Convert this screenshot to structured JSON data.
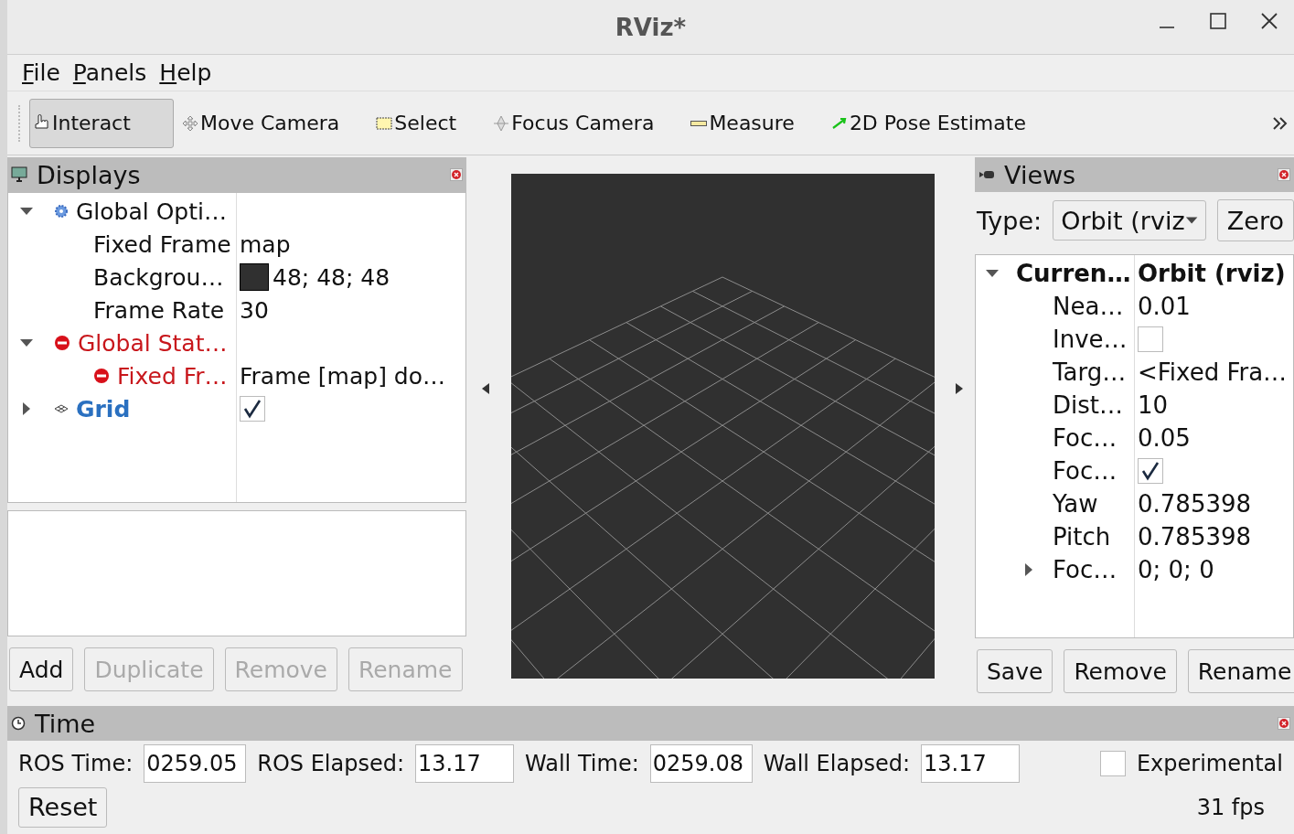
{
  "window": {
    "title": "RViz*"
  },
  "menu": [
    {
      "label": "File"
    },
    {
      "label": "Panels"
    },
    {
      "label": "Help"
    }
  ],
  "tools": [
    {
      "label": "Interact",
      "kind": "interact",
      "selected": true
    },
    {
      "label": "Move Camera",
      "kind": "move",
      "selected": false
    },
    {
      "label": "Select",
      "kind": "select",
      "selected": false
    },
    {
      "label": "Focus Camera",
      "kind": "focus",
      "selected": false
    },
    {
      "label": "Measure",
      "kind": "measure",
      "selected": false
    },
    {
      "label": "2D Pose Estimate",
      "kind": "pose",
      "selected": false
    }
  ],
  "displays": {
    "title": "Displays",
    "tree": [
      {
        "label": "Global Opti…",
        "kind": "options",
        "expanded": true,
        "children": [
          {
            "label": "Fixed Frame",
            "value": "map"
          },
          {
            "label": "Backgrou…",
            "value": "48; 48; 48",
            "color": "#303030"
          },
          {
            "label": "Frame Rate",
            "value": "30"
          }
        ]
      },
      {
        "label": "Global Stat…",
        "kind": "error",
        "expanded": true,
        "children": [
          {
            "label": "Fixed Fr…",
            "kind": "error",
            "value": "Frame [map] do…"
          }
        ]
      },
      {
        "label": "Grid",
        "kind": "grid",
        "expanded": false,
        "checked": true
      }
    ],
    "buttons": [
      {
        "label": "Add",
        "disabled": false
      },
      {
        "label": "Duplicate",
        "disabled": true
      },
      {
        "label": "Remove",
        "disabled": true
      },
      {
        "label": "Rename",
        "disabled": true
      }
    ]
  },
  "views": {
    "title": "Views",
    "type_label": "Type:",
    "type_value": "Orbit (rviz",
    "zero": "Zero",
    "tree": [
      {
        "label": "Curren…",
        "value": "Orbit (rviz)",
        "kind": "header",
        "expanded": true,
        "children": [
          {
            "label": "Nea…",
            "value": "0.01"
          },
          {
            "label": "Inve…",
            "checked": false
          },
          {
            "label": "Targ…",
            "value": "<Fixed Fra…"
          },
          {
            "label": "Dist…",
            "value": "10"
          },
          {
            "label": "Foc…",
            "value": "0.05"
          },
          {
            "label": "Foc…",
            "checked": true
          },
          {
            "label": "Yaw",
            "value": "0.785398"
          },
          {
            "label": "Pitch",
            "value": "0.785398"
          },
          {
            "label": "Foc…",
            "value": "0; 0; 0",
            "expanded": false
          }
        ]
      }
    ],
    "buttons": [
      {
        "label": "Save",
        "disabled": false
      },
      {
        "label": "Remove",
        "disabled": false
      },
      {
        "label": "Rename",
        "disabled": false
      }
    ]
  },
  "time": {
    "title": "Time",
    "fields": [
      {
        "label": "ROS Time:",
        "value": "0259.05"
      },
      {
        "label": "ROS Elapsed:",
        "value": "13.17"
      },
      {
        "label": "Wall Time:",
        "value": "0259.08"
      },
      {
        "label": "Wall Elapsed:",
        "value": "13.17"
      }
    ],
    "experimental": {
      "label": "Experimental",
      "checked": false
    },
    "reset": "Reset",
    "fps": "31 fps"
  }
}
